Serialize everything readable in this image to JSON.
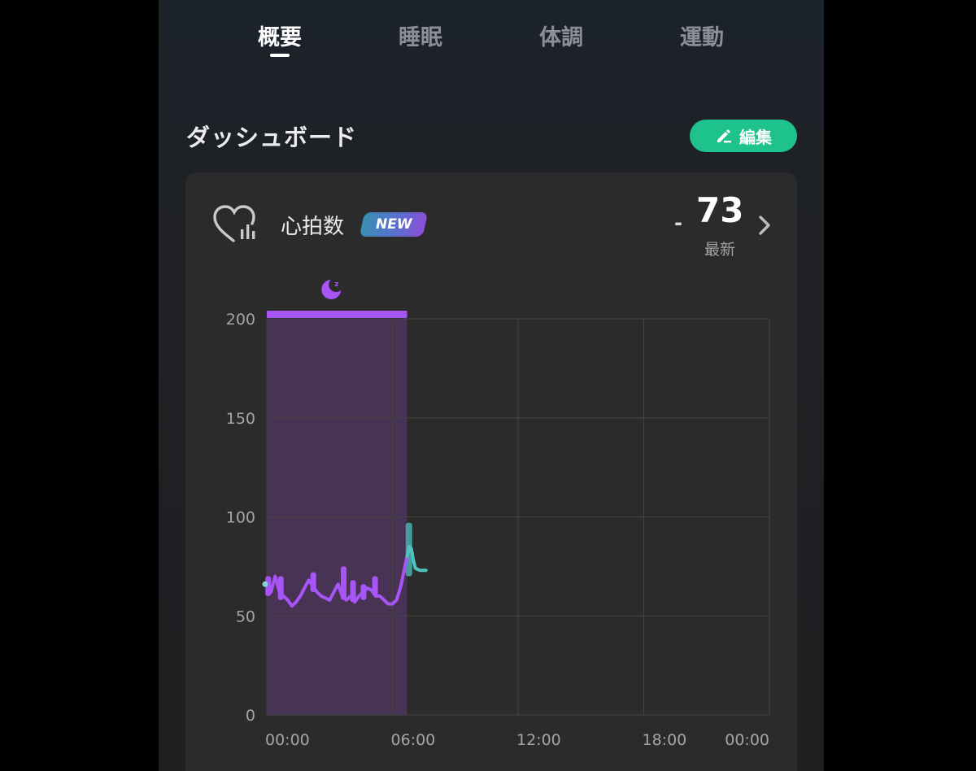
{
  "tabs": [
    {
      "label": "概要"
    },
    {
      "label": "睡眠"
    },
    {
      "label": "体調"
    },
    {
      "label": "運動"
    }
  ],
  "section": {
    "title": "ダッシュボード",
    "edit_label": "編集",
    "edit_icon": "pencil-icon"
  },
  "card": {
    "icon": "heart-rate-icon",
    "title": "心拍数",
    "badge": "NEW",
    "value": "73",
    "value_prefix": "-",
    "value_label": "最新"
  },
  "colors": {
    "accent_green": "#1ec28c",
    "sleep_purple": "#a855f7",
    "awake_teal": "#4fc3c0"
  },
  "chart_data": {
    "type": "line",
    "yticks": [
      "200",
      "150",
      "100",
      "50",
      "0"
    ],
    "ylim": [
      0,
      200
    ],
    "xticks": [
      "00:00",
      "06:00",
      "12:00",
      "18:00",
      "00:00"
    ],
    "x_hours": [
      0,
      6,
      12,
      18,
      24
    ],
    "grid": true,
    "sleep_period_hours": [
      0,
      6.7
    ],
    "series": [
      {
        "color": "#a855f7",
        "points": [
          [
            0.0,
            66
          ],
          [
            0.2,
            62
          ],
          [
            0.4,
            70
          ],
          [
            0.6,
            62
          ],
          [
            0.8,
            60
          ],
          [
            1.0,
            58
          ],
          [
            1.2,
            55
          ],
          [
            1.4,
            57
          ],
          [
            1.6,
            60
          ],
          [
            1.8,
            64
          ],
          [
            2.0,
            68
          ],
          [
            2.2,
            65
          ],
          [
            2.4,
            62
          ],
          [
            2.6,
            60
          ],
          [
            2.8,
            59
          ],
          [
            3.0,
            58
          ],
          [
            3.2,
            62
          ],
          [
            3.4,
            66
          ],
          [
            3.6,
            60
          ],
          [
            3.8,
            58
          ],
          [
            4.0,
            60
          ],
          [
            4.2,
            57
          ],
          [
            4.4,
            60
          ],
          [
            4.6,
            62
          ],
          [
            4.8,
            64
          ],
          [
            5.0,
            63
          ],
          [
            5.2,
            60
          ],
          [
            5.4,
            60
          ],
          [
            5.6,
            58
          ],
          [
            5.8,
            56
          ],
          [
            6.0,
            56
          ],
          [
            6.2,
            58
          ],
          [
            6.4,
            65
          ],
          [
            6.6,
            75
          ],
          [
            6.7,
            80
          ]
        ]
      },
      {
        "color": "#4fc3c0",
        "points": [
          [
            6.7,
            80
          ],
          [
            6.8,
            85
          ],
          [
            6.9,
            84
          ],
          [
            7.0,
            78
          ],
          [
            7.1,
            74
          ],
          [
            7.3,
            73
          ],
          [
            7.6,
            73
          ]
        ]
      }
    ],
    "range_bars": {
      "sleep": [
        [
          0.05,
          60,
          70
        ],
        [
          0.65,
          58,
          70
        ],
        [
          2.2,
          62,
          72
        ],
        [
          3.65,
          58,
          75
        ],
        [
          4.1,
          57,
          68
        ],
        [
          4.6,
          58,
          66
        ],
        [
          5.15,
          60,
          70
        ]
      ],
      "awake": [
        [
          6.75,
          70,
          97
        ]
      ]
    }
  }
}
